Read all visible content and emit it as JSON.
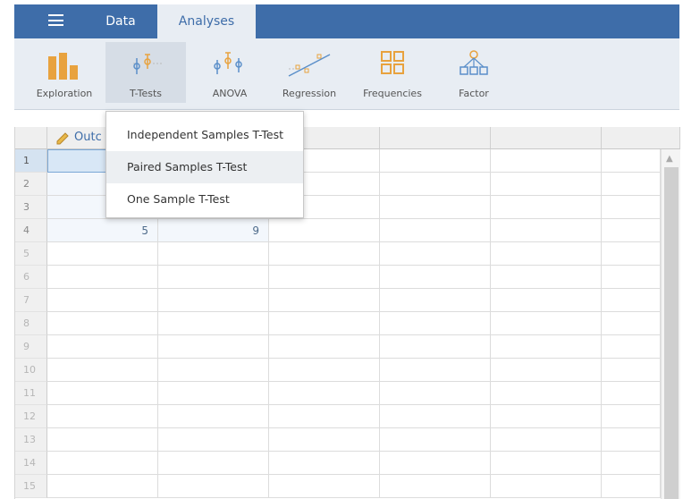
{
  "header": {
    "tabs": [
      {
        "label": "Data"
      },
      {
        "label": "Analyses"
      }
    ]
  },
  "ribbon": {
    "items": [
      {
        "label": "Exploration",
        "icon": "bar-chart-icon"
      },
      {
        "label": "T-Tests",
        "icon": "t-tests-icon"
      },
      {
        "label": "ANOVA",
        "icon": "anova-icon"
      },
      {
        "label": "Regression",
        "icon": "regression-icon"
      },
      {
        "label": "Frequencies",
        "icon": "frequencies-icon"
      },
      {
        "label": "Factor",
        "icon": "factor-icon"
      }
    ]
  },
  "menu": {
    "items": [
      {
        "label": "Independent Samples T-Test"
      },
      {
        "label": "Paired Samples T-Test"
      },
      {
        "label": "One Sample T-Test"
      }
    ]
  },
  "sheet": {
    "column1_visible_name": "Outc",
    "row_numbers": [
      "1",
      "2",
      "3",
      "4",
      "5",
      "6",
      "7",
      "8",
      "9",
      "10",
      "11",
      "12",
      "13",
      "14",
      "15"
    ],
    "row4": {
      "col1": "5",
      "col2": "9"
    }
  },
  "colors": {
    "brand_blue": "#3e6da9",
    "ribbon_bg": "#e8edf3",
    "icon_orange": "#e8a23e",
    "icon_blue": "#5b8fc9"
  }
}
